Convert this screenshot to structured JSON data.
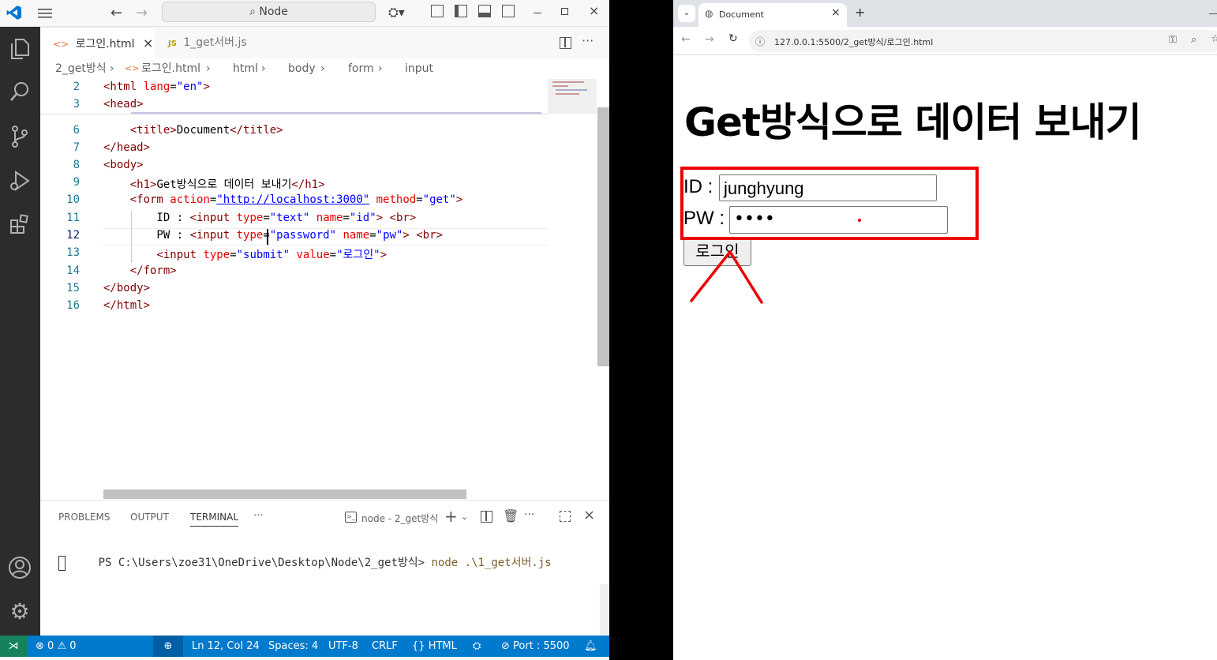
{
  "vscode": {
    "title_search": "Node",
    "tabs": [
      {
        "icon": "<>",
        "label": "로그인.html",
        "close": "×"
      },
      {
        "icon": "JS",
        "label": "1_get서버.js"
      }
    ],
    "breadcrumb": [
      "2_get방식",
      "로그인.html",
      "html",
      "body",
      "form",
      "input"
    ],
    "code_lines": [
      {
        "n": "2",
        "parts": [
          [
            "tg",
            "<html "
          ],
          [
            "at",
            "lang"
          ],
          [
            "tx",
            "="
          ],
          [
            "vl",
            "\"en\""
          ],
          [
            "tg",
            ">"
          ]
        ]
      },
      {
        "n": "3",
        "parts": [
          [
            "tg",
            "<head>"
          ]
        ]
      },
      {
        "n": "6",
        "parts": [
          [
            "tx",
            "    "
          ],
          [
            "tg",
            "<title>"
          ],
          [
            "tx",
            "Document"
          ],
          [
            "tg",
            "</title>"
          ]
        ]
      },
      {
        "n": "7",
        "parts": [
          [
            "tg",
            "</head>"
          ]
        ]
      },
      {
        "n": "8",
        "parts": [
          [
            "tg",
            "<body>"
          ]
        ]
      },
      {
        "n": "9",
        "parts": [
          [
            "tx",
            "    "
          ],
          [
            "tg",
            "<h1>"
          ],
          [
            "tx",
            "Get방식으로 데이터 보내기"
          ],
          [
            "tg",
            "</h1>"
          ]
        ]
      },
      {
        "n": "10",
        "parts": [
          [
            "tx",
            "    "
          ],
          [
            "tg",
            "<form "
          ],
          [
            "at",
            "action"
          ],
          [
            "tx",
            "="
          ],
          [
            "vl",
            "\"http://localhost:3000\""
          ],
          [
            "tx",
            " "
          ],
          [
            "at",
            "method"
          ],
          [
            "tx",
            "="
          ],
          [
            "vl",
            "\"get\""
          ],
          [
            "tg",
            ">"
          ]
        ]
      },
      {
        "n": "11",
        "parts": [
          [
            "tx",
            "        ID : "
          ],
          [
            "tg",
            "<input "
          ],
          [
            "at",
            "type"
          ],
          [
            "tx",
            "="
          ],
          [
            "vl",
            "\"text\""
          ],
          [
            "tx",
            " "
          ],
          [
            "at",
            "name"
          ],
          [
            "tx",
            "="
          ],
          [
            "vl",
            "\"id\""
          ],
          [
            "tg",
            ">"
          ],
          [
            "tx",
            " "
          ],
          [
            "tg",
            "<br>"
          ]
        ]
      },
      {
        "n": "12",
        "parts": [
          [
            "tx",
            "        PW : "
          ],
          [
            "tg",
            "<input "
          ],
          [
            "at",
            "type"
          ],
          [
            "tx",
            "="
          ],
          [
            "vl",
            "\"password\""
          ],
          [
            "tx",
            " "
          ],
          [
            "at",
            "name"
          ],
          [
            "tx",
            "="
          ],
          [
            "vl",
            "\"pw\""
          ],
          [
            "tg",
            ">"
          ],
          [
            "tx",
            " "
          ],
          [
            "tg",
            "<br>"
          ]
        ]
      },
      {
        "n": "13",
        "parts": [
          [
            "tx",
            "        "
          ],
          [
            "tg",
            "<input "
          ],
          [
            "at",
            "type"
          ],
          [
            "tx",
            "="
          ],
          [
            "vl",
            "\"submit\""
          ],
          [
            "tx",
            " "
          ],
          [
            "at",
            "value"
          ],
          [
            "tx",
            "="
          ],
          [
            "vl",
            "\"로그인\""
          ],
          [
            "tg",
            ">"
          ]
        ]
      },
      {
        "n": "14",
        "parts": [
          [
            "tx",
            "    "
          ],
          [
            "tg",
            "</form>"
          ]
        ]
      },
      {
        "n": "15",
        "parts": [
          [
            "tg",
            "</body>"
          ]
        ]
      },
      {
        "n": "16",
        "parts": [
          [
            "tg",
            "</html>"
          ]
        ]
      }
    ],
    "panel": {
      "tabs": [
        "PROBLEMS",
        "OUTPUT",
        "TERMINAL",
        "···"
      ],
      "terminal_name": "node - 2_get방식",
      "prompt": "PS C:\\Users\\zoe31\\OneDrive\\Desktop\\Node\\2_get방식>",
      "command": "node .\\1_get서버.js"
    },
    "status": {
      "errors": "0",
      "warnings": "0",
      "position": "Ln 12, Col 24",
      "spaces": "Spaces: 4",
      "encoding": "UTF-8",
      "eol": "CRLF",
      "language": "HTML",
      "port": "Port : 5500"
    }
  },
  "browser": {
    "tab_title": "Document",
    "url": "127.0.0.1:5500/2_get방식/로그인.html",
    "heading": "Get방식으로 데이터 보내기",
    "id_label": "ID :",
    "id_value": "junghyung",
    "pw_label": "PW :",
    "pw_value": "••••",
    "submit_label": "로그인",
    "annotation_color": "#ee0000"
  }
}
